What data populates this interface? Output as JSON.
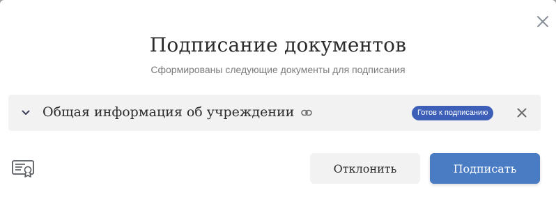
{
  "dialog": {
    "title": "Подписание документов",
    "subtitle": "Сформированы следующие документы для подписания",
    "close_icon": "close-icon"
  },
  "documents": [
    {
      "name": "Общая информация об учреждении",
      "status": "Готов к подписанию",
      "status_color": "#3d5fb8",
      "expand_icon": "chevron-down-icon",
      "link_icon": "link-icon",
      "remove_icon": "close-icon"
    }
  ],
  "footer": {
    "certificate_icon": "certificate-icon",
    "decline_label": "Отклонить",
    "sign_label": "Подписать",
    "sign_color": "#4a7cc4"
  }
}
